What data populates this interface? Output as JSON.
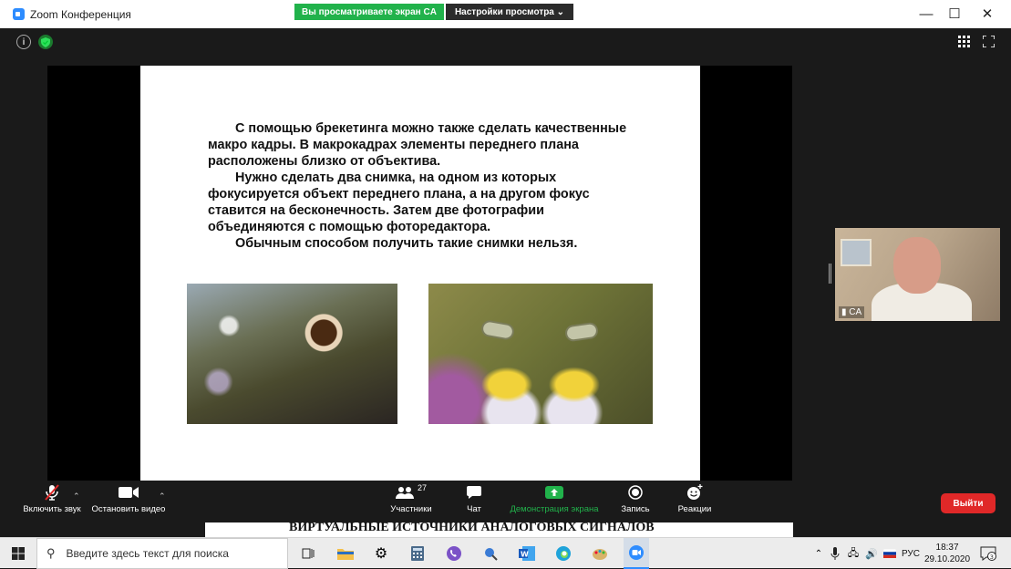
{
  "window": {
    "title": "Zoom Конференция",
    "minimize": "—",
    "maximize": "☐",
    "close": "✕"
  },
  "share": {
    "banner": "Вы просматриваете экран CA",
    "view_options": "Настройки просмотра ⌄"
  },
  "slide": {
    "paragraphs": [
      "С помощью брекетинга можно также сделать качественные макро кадры. В макрокадрах элементы переднего плана расположены близко от объектива.",
      "Нужно сделать два снимка, на одном из которых фокусируется объект переднего плана, а на другом фокус ставится на бесконечность. Затем две фотографии объединяются с помощью фоторедактора.",
      "Обычным способом получить такие снимки нельзя."
    ]
  },
  "participant_video": {
    "name": "CA"
  },
  "toolbar": {
    "mute": "Включить звук",
    "video": "Остановить видео",
    "participants": "Участники",
    "participants_count": "27",
    "chat": "Чат",
    "share_screen": "Демонстрация экрана",
    "record": "Запись",
    "reactions": "Реакции",
    "leave": "Выйти",
    "share_color": "#21b24b",
    "leave_color": "#e02828"
  },
  "background_document": {
    "text": "ВИРТУАЛЬНЫЕ ИСТОЧНИКИ АНАЛОГОВЫХ СИГНАЛОВ"
  },
  "taskbar": {
    "search_placeholder": "Введите здесь текст для поиска",
    "lang": "РУС",
    "time": "18:37",
    "date": "29.10.2020",
    "notifications": "3"
  }
}
